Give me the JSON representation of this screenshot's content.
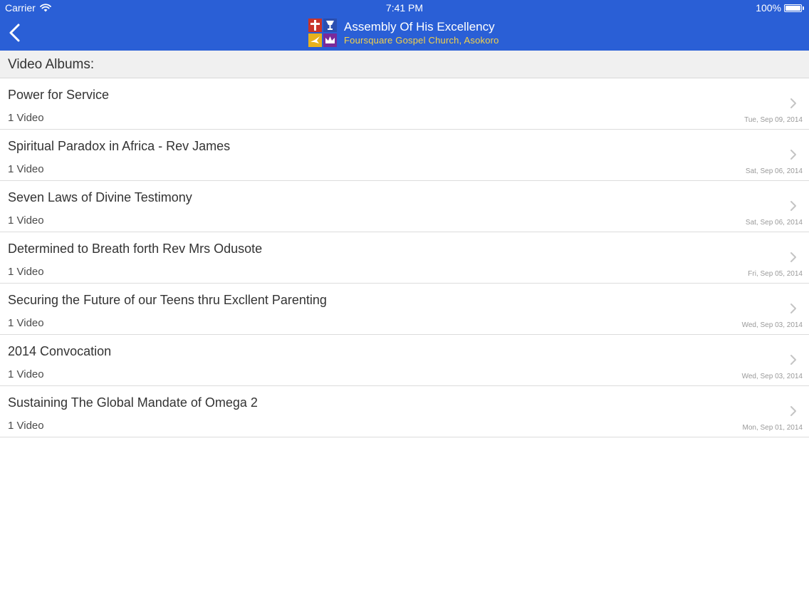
{
  "status_bar": {
    "carrier": "Carrier",
    "time": "7:41 PM",
    "battery": "100%",
    "battery_level": 1.0
  },
  "nav": {
    "back_icon": "chevron-left-icon",
    "title": "Assembly Of His Excellency",
    "subtitle": "Foursquare Gospel Church, Asokoro"
  },
  "colors": {
    "header_blue": "#2a5fd6",
    "subtitle_yellow": "#f3d24a",
    "section_bg": "#f0f0f0"
  },
  "section": {
    "title": "Video Albums:"
  },
  "albums": [
    {
      "title": "Power for Service",
      "count": "1 Video",
      "date": "Tue, Sep 09, 2014"
    },
    {
      "title": "Spiritual Paradox in Africa - Rev James",
      "count": "1 Video",
      "date": "Sat, Sep 06, 2014"
    },
    {
      "title": "Seven Laws of Divine Testimony",
      "count": "1 Video",
      "date": "Sat, Sep 06, 2014"
    },
    {
      "title": "Determined to Breath forth Rev Mrs Odusote",
      "count": "1 Video",
      "date": "Fri, Sep 05, 2014"
    },
    {
      "title": "Securing the Future of our Teens thru Excllent Parenting",
      "count": "1 Video",
      "date": "Wed, Sep 03, 2014"
    },
    {
      "title": "2014 Convocation",
      "count": "1 Video",
      "date": "Wed, Sep 03, 2014"
    },
    {
      "title": "Sustaining The Global Mandate of Omega 2",
      "count": "1 Video",
      "date": "Mon, Sep 01, 2014"
    }
  ]
}
